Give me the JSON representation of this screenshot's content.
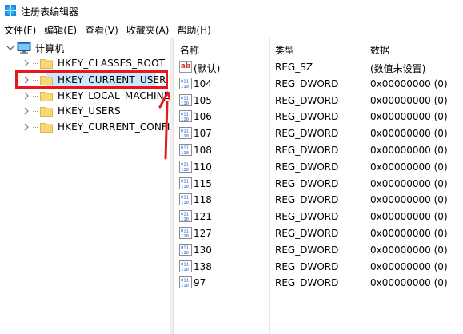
{
  "window": {
    "title": "注册表编辑器"
  },
  "menu": [
    "文件(F)",
    "编辑(E)",
    "查看(V)",
    "收藏夹(A)",
    "帮助(H)"
  ],
  "tree": {
    "root": "计算机",
    "items": [
      {
        "label": "HKEY_CLASSES_ROOT",
        "selected": false
      },
      {
        "label": "HKEY_CURRENT_USER",
        "selected": true
      },
      {
        "label": "HKEY_LOCAL_MACHINE",
        "selected": false
      },
      {
        "label": "HKEY_USERS",
        "selected": false
      },
      {
        "label": "HKEY_CURRENT_CONFIG",
        "selected": false
      }
    ]
  },
  "list": {
    "columns": [
      "名称",
      "类型",
      "数据"
    ],
    "rows": [
      {
        "name": "(默认)",
        "type": "REG_SZ",
        "data": "(数值未设置)",
        "icon": "string-value-icon"
      },
      {
        "name": "104",
        "type": "REG_DWORD",
        "data": "0x00000000 (0)",
        "icon": "binary-value-icon"
      },
      {
        "name": "105",
        "type": "REG_DWORD",
        "data": "0x00000000 (0)",
        "icon": "binary-value-icon"
      },
      {
        "name": "106",
        "type": "REG_DWORD",
        "data": "0x00000000 (0)",
        "icon": "binary-value-icon"
      },
      {
        "name": "107",
        "type": "REG_DWORD",
        "data": "0x00000000 (0)",
        "icon": "binary-value-icon"
      },
      {
        "name": "108",
        "type": "REG_DWORD",
        "data": "0x00000000 (0)",
        "icon": "binary-value-icon"
      },
      {
        "name": "110",
        "type": "REG_DWORD",
        "data": "0x00000000 (0)",
        "icon": "binary-value-icon"
      },
      {
        "name": "115",
        "type": "REG_DWORD",
        "data": "0x00000000 (0)",
        "icon": "binary-value-icon"
      },
      {
        "name": "118",
        "type": "REG_DWORD",
        "data": "0x00000000 (0)",
        "icon": "binary-value-icon"
      },
      {
        "name": "121",
        "type": "REG_DWORD",
        "data": "0x00000000 (0)",
        "icon": "binary-value-icon"
      },
      {
        "name": "127",
        "type": "REG_DWORD",
        "data": "0x00000000 (0)",
        "icon": "binary-value-icon"
      },
      {
        "name": "130",
        "type": "REG_DWORD",
        "data": "0x00000000 (0)",
        "icon": "binary-value-icon"
      },
      {
        "name": "138",
        "type": "REG_DWORD",
        "data": "0x00000000 (0)",
        "icon": "binary-value-icon"
      },
      {
        "name": "97",
        "type": "REG_DWORD",
        "data": "0x00000000 (0)",
        "icon": "binary-value-icon"
      }
    ]
  },
  "annotation": {
    "highlight_color": "#e8171b"
  }
}
